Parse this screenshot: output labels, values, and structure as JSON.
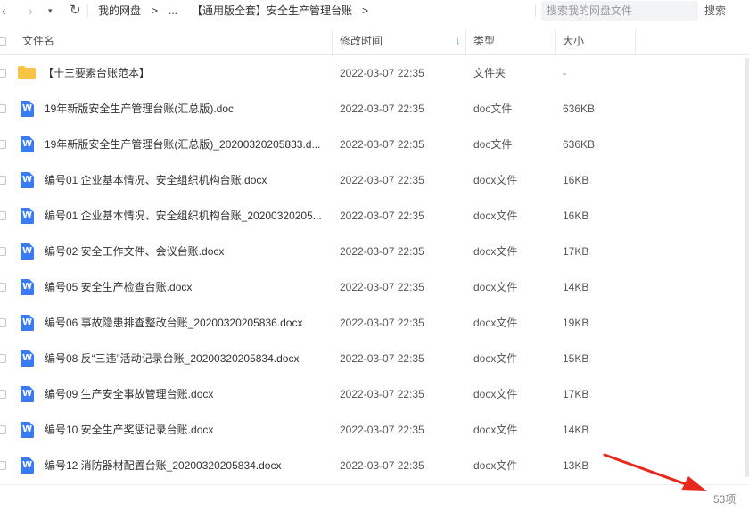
{
  "toolbar": {
    "breadcrumb": [
      "我的网盘",
      ">",
      "...",
      "【通用版全套】安全生产管理台账",
      ">"
    ],
    "search_placeholder": "搜索我的网盘文件",
    "search_button": "搜索"
  },
  "table": {
    "columns": {
      "name": "文件名",
      "modified": "修改时间",
      "type": "类型",
      "size": "大小"
    },
    "sort_indicator": "↓",
    "rows": [
      {
        "icon": "folder-icon",
        "name": "【十三要素台账范本】",
        "modified": "2022-03-07 22:35",
        "type": "文件夹",
        "size": "-"
      },
      {
        "icon": "word-doc-icon",
        "name": "19年新版安全生产管理台账(汇总版).doc",
        "modified": "2022-03-07 22:35",
        "type": "doc文件",
        "size": "636KB"
      },
      {
        "icon": "word-doc-icon",
        "name": "19年新版安全生产管理台账(汇总版)_20200320205833.d...",
        "modified": "2022-03-07 22:35",
        "type": "doc文件",
        "size": "636KB"
      },
      {
        "icon": "word-doc-icon",
        "name": "编号01 企业基本情况、安全组织机构台账.docx",
        "modified": "2022-03-07 22:35",
        "type": "docx文件",
        "size": "16KB"
      },
      {
        "icon": "word-doc-icon",
        "name": "编号01 企业基本情况、安全组织机构台账_20200320205...",
        "modified": "2022-03-07 22:35",
        "type": "docx文件",
        "size": "16KB"
      },
      {
        "icon": "word-doc-icon",
        "name": "编号02 安全工作文件、会议台账.docx",
        "modified": "2022-03-07 22:35",
        "type": "docx文件",
        "size": "17KB"
      },
      {
        "icon": "word-doc-icon",
        "name": "编号05 安全生产检查台账.docx",
        "modified": "2022-03-07 22:35",
        "type": "docx文件",
        "size": "14KB"
      },
      {
        "icon": "word-doc-icon",
        "name": "编号06 事故隐患排查整改台账_20200320205836.docx",
        "modified": "2022-03-07 22:35",
        "type": "docx文件",
        "size": "19KB"
      },
      {
        "icon": "word-doc-icon",
        "name": "编号08 反“三违”活动记录台账_20200320205834.docx",
        "modified": "2022-03-07 22:35",
        "type": "docx文件",
        "size": "15KB"
      },
      {
        "icon": "word-doc-icon",
        "name": "编号09 生产安全事故管理台账.docx",
        "modified": "2022-03-07 22:35",
        "type": "docx文件",
        "size": "17KB"
      },
      {
        "icon": "word-doc-icon",
        "name": "编号10 安全生产奖惩记录台账.docx",
        "modified": "2022-03-07 22:35",
        "type": "docx文件",
        "size": "14KB"
      },
      {
        "icon": "word-doc-icon",
        "name": "编号12 消防器材配置台账_20200320205834.docx",
        "modified": "2022-03-07 22:35",
        "type": "docx文件",
        "size": "13KB"
      }
    ]
  },
  "footer": {
    "item_count": "53项"
  },
  "colors": {
    "accent": "#3b8cff",
    "word_icon": "#3b7bf0",
    "folder": "#f7c443",
    "arrow": "#e8281e"
  }
}
